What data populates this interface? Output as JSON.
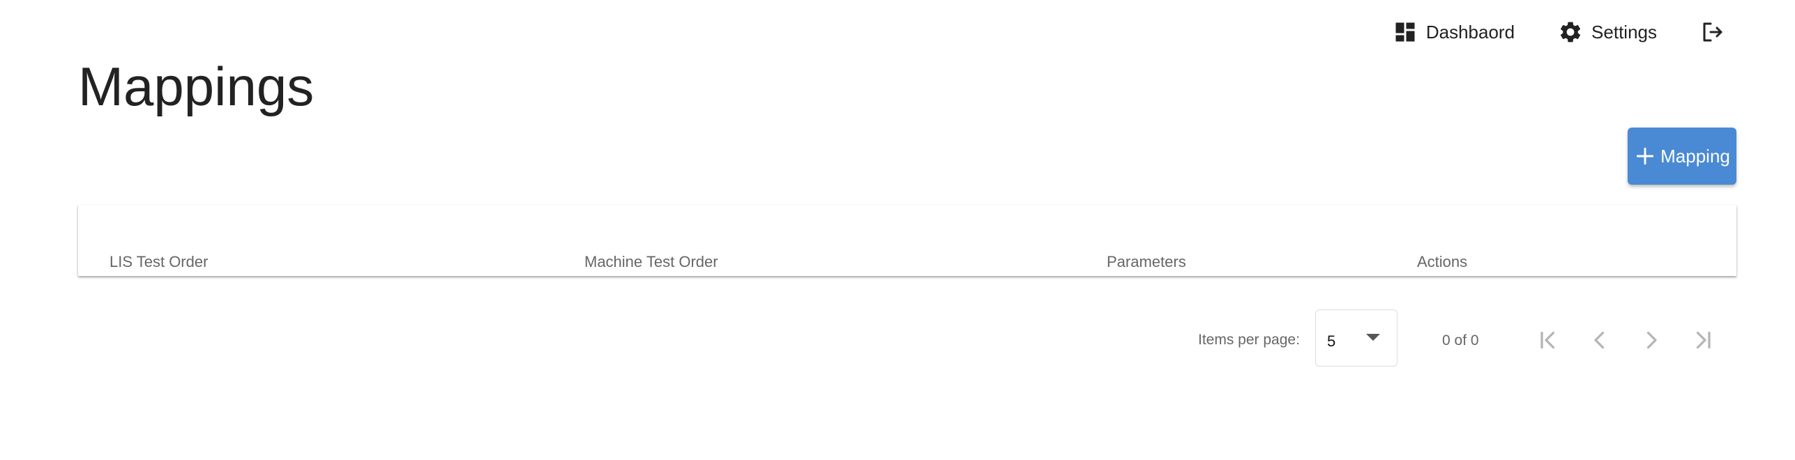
{
  "header": {
    "nav": {
      "dashboard_label": "Dashbaord",
      "settings_label": "Settings"
    },
    "icons": {
      "dashboard": "dashboard-icon",
      "settings": "gear-icon",
      "logout": "logout-icon"
    }
  },
  "page": {
    "title": "Mappings"
  },
  "actions": {
    "add_mapping_label": "Mapping",
    "add_icon": "plus-icon"
  },
  "table": {
    "columns": [
      "LIS Test Order",
      "Machine Test Order",
      "Parameters",
      "Actions"
    ],
    "rows": []
  },
  "paginator": {
    "items_per_page_label": "Items per page:",
    "items_per_page_value": "5",
    "range_label": "0 of 0",
    "icons": [
      "first-page-icon",
      "previous-page-icon",
      "next-page-icon",
      "last-page-icon"
    ]
  },
  "colors": {
    "accent": "#4a8ad4",
    "text": "#222222",
    "muted": "#666666",
    "disabled_icon": "#b5b5b5"
  }
}
